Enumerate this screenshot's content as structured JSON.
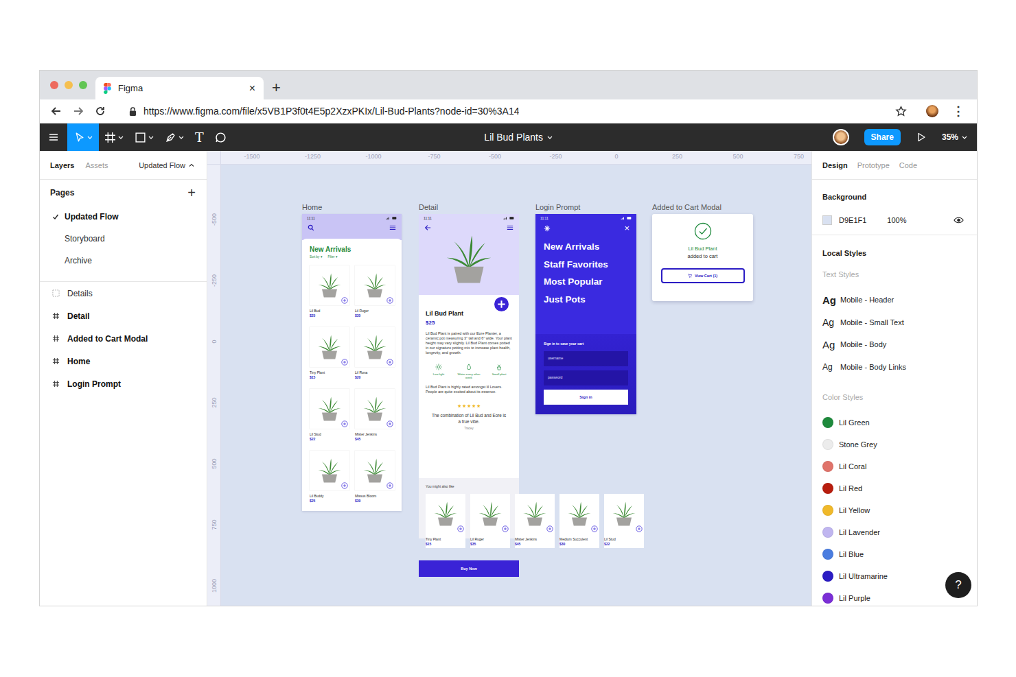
{
  "browser": {
    "tab": {
      "title": "Figma",
      "close": "×",
      "selected": true
    },
    "new_tab": "+",
    "url": "https://www.figma.com/file/x5VB1P3f0t4E5p2XzxPKIx/Lil-Bud-Plants?node-id=30%3A14",
    "menu": "⋮"
  },
  "toolbar": {
    "tools": [
      {
        "kind": "move",
        "selected": true
      },
      {
        "kind": "frame",
        "selected": false
      },
      {
        "kind": "shape",
        "selected": false
      },
      {
        "kind": "pen",
        "selected": false
      },
      {
        "kind": "text",
        "label": "T",
        "selected": false
      },
      {
        "kind": "comment",
        "selected": false
      }
    ],
    "file_name": "Lil Bud Plants",
    "share": "Share",
    "zoom": "35%"
  },
  "left_panel": {
    "tabs": [
      {
        "label": "Layers",
        "selected": true
      },
      {
        "label": "Assets",
        "selected": false
      }
    ],
    "page_select": "Updated Flow",
    "pages_title": "Pages",
    "add": "+",
    "pages": [
      {
        "name": "Updated Flow",
        "selected": true
      },
      {
        "name": "Storyboard",
        "selected": false
      },
      {
        "name": "Archive",
        "selected": false
      }
    ],
    "layers": [
      {
        "name": "Details",
        "kind": "section"
      },
      {
        "name": "Detail",
        "kind": "frame"
      },
      {
        "name": "Added to Cart Modal",
        "kind": "frame"
      },
      {
        "name": "Home",
        "kind": "frame"
      },
      {
        "name": "Login Prompt",
        "kind": "frame"
      }
    ]
  },
  "rulers": {
    "horizontal": [
      "-1500",
      "-1250",
      "-1000",
      "-750",
      "-500",
      "-250",
      "0",
      "250",
      "500",
      "750"
    ],
    "vertical": [
      "-500",
      "-250",
      "0",
      "250",
      "500",
      "750",
      "1000"
    ]
  },
  "frames": {
    "home": {
      "label": "Home",
      "time": "11:11",
      "title": "New Arrivals",
      "sort": "Sort by ▾",
      "filter": "Filter ▾",
      "products": [
        {
          "name": "Lil Bud",
          "price": "$25"
        },
        {
          "name": "Lil Ruger",
          "price": "$35"
        },
        {
          "name": "Tiny Plant",
          "price": "$15"
        },
        {
          "name": "Lil Rona",
          "price": "$20"
        },
        {
          "name": "Lil Stud",
          "price": "$22"
        },
        {
          "name": "Mister Jenkins",
          "price": "$45"
        },
        {
          "name": "Lil Buddy",
          "price": "$25"
        },
        {
          "name": "Missus Bloom",
          "price": "$30"
        }
      ]
    },
    "detail": {
      "label": "Detail",
      "time": "11:11",
      "name": "Lil Bud Plant",
      "price": "$25",
      "description": "Lil Bud Plant is paired with our Eore Planter, a ceramic pot measuring 3\" tall and 6\" wide. Your plant height may vary slightly. Lil Bud Plant comes potted in our signature potting mix to increase plant health, longevity, and growth.",
      "features": [
        {
          "kind": "light",
          "label": "Low light"
        },
        {
          "kind": "water",
          "label": "Water every other week"
        },
        {
          "kind": "size",
          "label": "Small plant"
        }
      ],
      "note": "Lil Bud Plant is highly rated amongst lil Lovers. People are quite excited about its essence.",
      "stars": 5,
      "review": "The combination of Lil Bud and Eore is a true vibe.",
      "reviewer": "Tracey",
      "also_like": "You might also like",
      "recommendations": [
        {
          "name": "Tiny Plant",
          "price": "$15"
        },
        {
          "name": "Lil Ruger",
          "price": "$35"
        },
        {
          "name": "Mister Jenkins",
          "price": "$45"
        },
        {
          "name": "Medium Succulent",
          "price": "$30"
        },
        {
          "name": "Lil Stud",
          "price": "$22"
        }
      ],
      "buy": "Buy Now"
    },
    "login": {
      "label": "Login Prompt",
      "time": "11:11",
      "close": "×",
      "menu": [
        "New Arrivals",
        "Staff Favorites",
        "Most Popular",
        "Just Pots"
      ],
      "prompt": "Sign in to save your cart",
      "fields": [
        {
          "placeholder": "username"
        },
        {
          "placeholder": "password"
        }
      ],
      "button": "Sign in"
    },
    "modal": {
      "label": "Added to Cart Modal",
      "title": "Lil Bud Plant",
      "subtitle": "added to cart",
      "button": "View Cart (1)"
    }
  },
  "right_panel": {
    "tabs": [
      {
        "label": "Design",
        "selected": true
      },
      {
        "label": "Prototype",
        "selected": false
      },
      {
        "label": "Code",
        "selected": false
      }
    ],
    "background": {
      "title": "Background",
      "hex": "D9E1F1",
      "opacity": "100%",
      "visible": true
    },
    "local_styles": "Local Styles",
    "text_styles_title": "Text Styles",
    "text_styles": [
      {
        "sample": "Ag",
        "name": "Mobile - Header",
        "kind": "header"
      },
      {
        "sample": "Ag",
        "name": "Mobile - Small Text",
        "kind": "small"
      },
      {
        "sample": "Ag",
        "name": "Mobile - Body",
        "kind": "body"
      },
      {
        "sample": "Ag",
        "name": "Mobile - Body Links",
        "kind": "link"
      }
    ],
    "color_styles_title": "Color Styles",
    "color_styles": [
      {
        "name": "Lil Green",
        "color": "#1e8a3c"
      },
      {
        "name": "Stone Grey",
        "color": "#ececec"
      },
      {
        "name": "Lil Coral",
        "color": "#e0736a"
      },
      {
        "name": "Lil Red",
        "color": "#b81d0e"
      },
      {
        "name": "Lil Yellow",
        "color": "#f0b92a"
      },
      {
        "name": "Lil Lavender",
        "color": "#c0b6f0"
      },
      {
        "name": "Lil Blue",
        "color": "#4a7de0"
      },
      {
        "name": "Lil Ultramarine",
        "color": "#2b1cc4"
      },
      {
        "name": "Lil Purple",
        "color": "#7b2fd6"
      }
    ]
  },
  "help": "?"
}
